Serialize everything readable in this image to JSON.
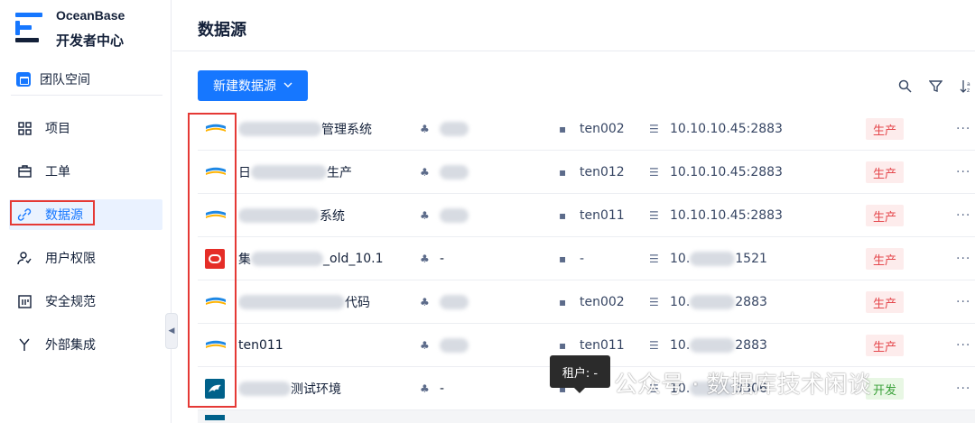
{
  "brand": {
    "name_en": "OceanBase",
    "name_cn": "开发者中心"
  },
  "space": {
    "label": "团队空间"
  },
  "nav": [
    {
      "label": "项目",
      "icon": "grid-icon"
    },
    {
      "label": "工单",
      "icon": "ticket-icon"
    },
    {
      "label": "数据源",
      "icon": "link-icon",
      "active": true
    },
    {
      "label": "用户权限",
      "icon": "user-permission-icon"
    },
    {
      "label": "安全规范",
      "icon": "security-rules-icon"
    },
    {
      "label": "外部集成",
      "icon": "integration-icon"
    }
  ],
  "page": {
    "title": "数据源",
    "new_button": "新建数据源"
  },
  "rows": [
    {
      "icon": "oceanbase-icon",
      "name_suffix": "管理系统",
      "owner": "",
      "tenant": "ten002",
      "host": "10.10.10.45:2883",
      "env": "生产"
    },
    {
      "icon": "oceanbase-icon",
      "name_prefix": "日",
      "name_suffix": "生产",
      "owner": "",
      "tenant": "ten012",
      "host": "10.10.10.45:2883",
      "env": "生产"
    },
    {
      "icon": "oceanbase-icon",
      "name_suffix": "系统",
      "owner": "",
      "tenant": "ten011",
      "host": "10.10.10.45:2883",
      "env": "生产"
    },
    {
      "icon": "oracle-icon",
      "name_prefix": "集",
      "name_suffix": "_old_10.1",
      "owner": "-",
      "tenant": "-",
      "host_prefix": "10.",
      "host_suffix": "1521",
      "env": "生产"
    },
    {
      "icon": "oceanbase-icon",
      "name_suffix": "代码",
      "owner": "",
      "tenant": "ten002",
      "host_prefix": "10.",
      "host_suffix": "2883",
      "env": "生产"
    },
    {
      "icon": "oceanbase-icon",
      "name": "ten011",
      "owner": "",
      "tenant": "ten011",
      "host_prefix": "10.",
      "host_suffix": "2883",
      "env": "生产"
    },
    {
      "icon": "mysql-icon",
      "name_suffix": "测试环境",
      "owner": "-",
      "tenant": "",
      "host_prefix": "10.",
      "host_suffix": "3306",
      "env": "开发"
    }
  ],
  "tooltip": {
    "text": "租户: -"
  },
  "watermark": {
    "text": "公众号 · 数据库技术闲谈"
  },
  "colors": {
    "primary": "#1677ff",
    "prod": "#e5484d",
    "dev": "#3aa13a",
    "highlight": "#e53935"
  }
}
